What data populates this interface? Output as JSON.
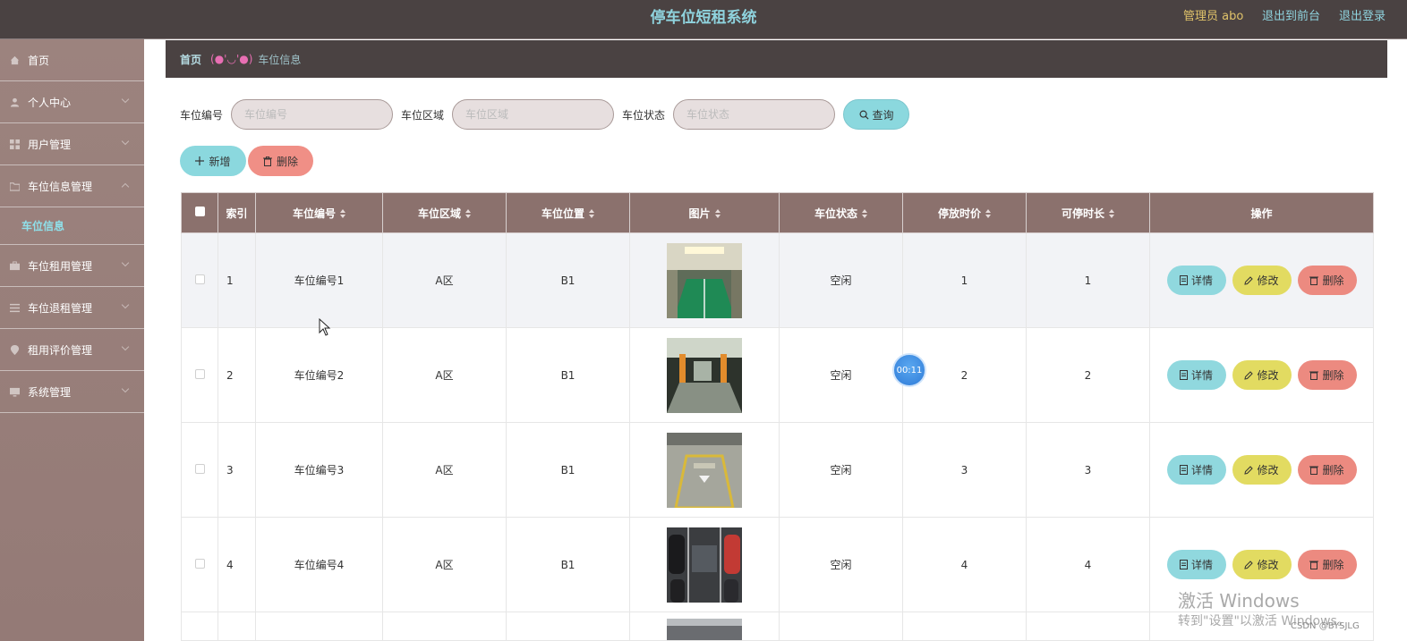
{
  "header": {
    "title": "停车位短租系统",
    "admin": "管理员 abo",
    "link_front": "退出到前台",
    "link_logout": "退出登录"
  },
  "sidebar": {
    "items": [
      {
        "label": "首页"
      },
      {
        "label": "个人中心"
      },
      {
        "label": "用户管理"
      },
      {
        "label": "车位信息管理"
      },
      {
        "label": "车位租用管理"
      },
      {
        "label": "车位退租管理"
      },
      {
        "label": "租用评价管理"
      },
      {
        "label": "系统管理"
      }
    ],
    "submenu_active": "车位信息"
  },
  "breadcrumb": {
    "home": "首页",
    "face": "(●'◡'●)",
    "current": "车位信息"
  },
  "search": {
    "code_label": "车位编号",
    "code_placeholder": "车位编号",
    "area_label": "车位区域",
    "area_placeholder": "车位区域",
    "status_label": "车位状态",
    "status_placeholder": "车位状态",
    "query_label": "查询"
  },
  "actions": {
    "add_label": "新增",
    "delete_label": "删除"
  },
  "table": {
    "columns": [
      "索引",
      "车位编号",
      "车位区域",
      "车位位置",
      "图片",
      "车位状态",
      "停放时价",
      "可停时长",
      "操作"
    ],
    "row_actions": {
      "detail": "详情",
      "edit": "修改",
      "remove": "删除"
    },
    "rows": [
      {
        "index": "1",
        "code": "车位编号1",
        "area": "A区",
        "position": "B1",
        "status": "空闲",
        "price": "1",
        "duration": "1"
      },
      {
        "index": "2",
        "code": "车位编号2",
        "area": "A区",
        "position": "B1",
        "status": "空闲",
        "price": "2",
        "duration": "2"
      },
      {
        "index": "3",
        "code": "车位编号3",
        "area": "A区",
        "position": "B1",
        "status": "空闲",
        "price": "3",
        "duration": "3"
      },
      {
        "index": "4",
        "code": "车位编号4",
        "area": "A区",
        "position": "B1",
        "status": "空闲",
        "price": "4",
        "duration": "4"
      }
    ]
  },
  "overlay": {
    "timer": "00:11",
    "watermark_title": "激活 Windows",
    "watermark_sub": "转到\"设置\"以激活 Windows。",
    "credit": "CSDN @BYSJLG"
  },
  "colors": {
    "topbar": "#4a4242",
    "sidebar": "#9c837e",
    "accent": "#8bd8de",
    "table_header": "#8b716d",
    "danger": "#f08f86",
    "warning": "#e2db61"
  }
}
